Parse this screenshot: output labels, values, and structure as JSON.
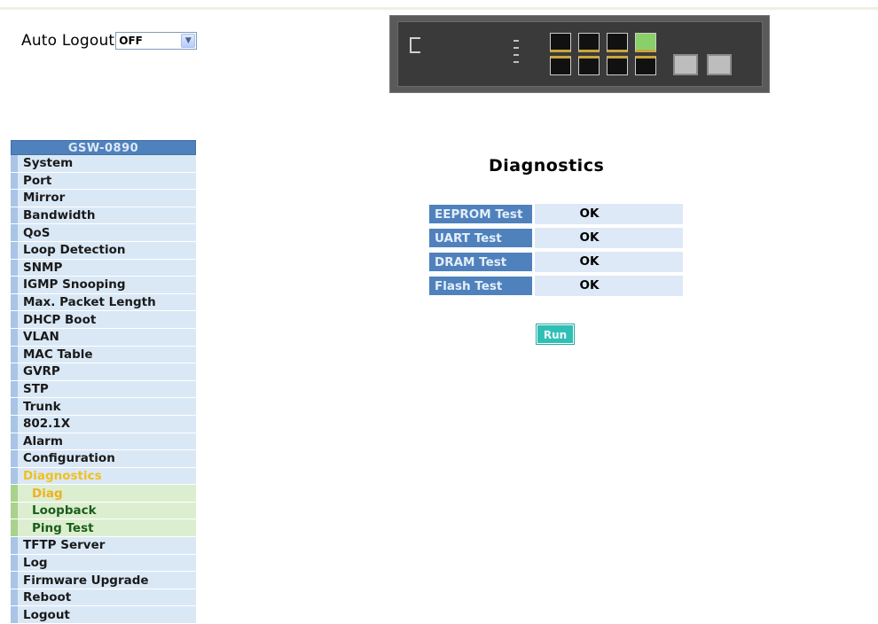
{
  "auto_logout": {
    "label": "Auto Logout",
    "value": "OFF"
  },
  "sidebar": {
    "title": "GSW-0890",
    "items": [
      {
        "label": "System"
      },
      {
        "label": "Port"
      },
      {
        "label": "Mirror"
      },
      {
        "label": "Bandwidth"
      },
      {
        "label": "QoS"
      },
      {
        "label": "Loop Detection"
      },
      {
        "label": "SNMP"
      },
      {
        "label": "IGMP Snooping"
      },
      {
        "label": "Max. Packet Length"
      },
      {
        "label": "DHCP Boot"
      },
      {
        "label": "VLAN"
      },
      {
        "label": "MAC Table"
      },
      {
        "label": "GVRP"
      },
      {
        "label": "STP"
      },
      {
        "label": "Trunk"
      },
      {
        "label": "802.1X"
      },
      {
        "label": "Alarm"
      },
      {
        "label": "Configuration"
      },
      {
        "label": "Diagnostics"
      },
      {
        "label": "Diag"
      },
      {
        "label": "Loopback"
      },
      {
        "label": "Ping Test"
      },
      {
        "label": "TFTP Server"
      },
      {
        "label": "Log"
      },
      {
        "label": "Firmware Upgrade"
      },
      {
        "label": "Reboot"
      },
      {
        "label": "Logout"
      }
    ]
  },
  "main": {
    "title": "Diagnostics",
    "tests": [
      {
        "name": "EEPROM Test",
        "result": "OK"
      },
      {
        "name": "UART Test",
        "result": "OK"
      },
      {
        "name": "DRAM Test",
        "result": "OK"
      },
      {
        "name": "Flash Test",
        "result": "OK"
      }
    ],
    "run_label": "Run"
  },
  "colors": {
    "sidebar_header": "#4f81bd",
    "sidebar_item_bg": "#dae8f6",
    "submenu_bg": "#dceed0",
    "active_text": "#f0c020",
    "run_button": "#30bfb5"
  }
}
